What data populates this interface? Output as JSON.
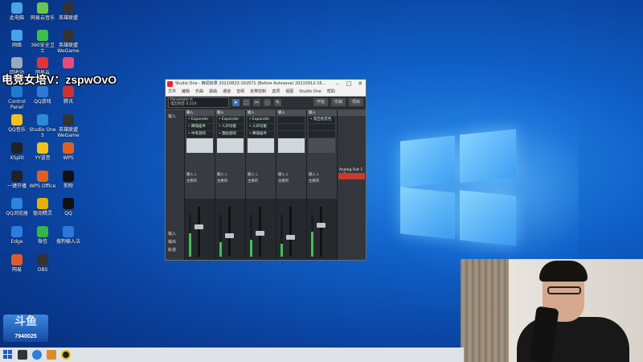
{
  "watermark": {
    "text": "电竞女培V：zspwOvO"
  },
  "desktop_icons": [
    {
      "label": "此电脑",
      "color": "#4aa3e8"
    },
    {
      "label": "网易云音乐",
      "color": "#65c84a"
    },
    {
      "label": "英雄联盟",
      "color": "#333333"
    },
    {
      "label": "网络",
      "color": "#4aa3e8"
    },
    {
      "label": "360安全卫士",
      "color": "#3dbf4a"
    },
    {
      "label": "英雄联盟WeGame",
      "color": "#333333"
    },
    {
      "label": "回收站",
      "color": "#9ab"
    },
    {
      "label": "网易云",
      "color": "#e2333b"
    },
    {
      "label": "",
      "color": "#e84b7a"
    },
    {
      "label": "Control Panel",
      "color": "#1f7bd0"
    },
    {
      "label": "QQ游戏",
      "color": "#2e7bd6"
    },
    {
      "label": "腾讯",
      "color": "#cc3333"
    },
    {
      "label": "QQ音乐",
      "color": "#f0c21a"
    },
    {
      "label": "Studio One 5",
      "color": "#2b8ad6"
    },
    {
      "label": "英雄联盟WeGame",
      "color": "#333333"
    },
    {
      "label": "XSplit",
      "color": "#222222"
    },
    {
      "label": "YY语音",
      "color": "#f2c31b"
    },
    {
      "label": "WPS",
      "color": "#e06020"
    },
    {
      "label": "一键开播",
      "color": "#222222"
    },
    {
      "label": "WPS Office",
      "color": "#e06020"
    },
    {
      "label": "剪映",
      "color": "#111111"
    },
    {
      "label": "QQ浏览器",
      "color": "#2f82e0"
    },
    {
      "label": "驱动精灵",
      "color": "#e6b000"
    },
    {
      "label": "QQ",
      "color": "#111111"
    },
    {
      "label": "Edge",
      "color": "#2c7de0"
    },
    {
      "label": "微信",
      "color": "#36b54a"
    },
    {
      "label": "搜狗输入法",
      "color": "#2b78d8"
    },
    {
      "label": "网易",
      "color": "#e05a2a"
    },
    {
      "label": "OBS",
      "color": "#333333"
    }
  ],
  "channel_badge": {
    "logo": "斗鱼",
    "label": "鲨鱼号",
    "id": "7940025"
  },
  "studio_one": {
    "title": "Studio One - 精调效果 20210823-162671 (Before Autosave) 20210912-16...",
    "menu": [
      "文件",
      "编辑",
      "乐曲",
      "歌曲",
      "通道",
      "音频",
      "走带控制",
      "选项",
      "视图",
      "Studio One",
      "帮助"
    ],
    "instrument": "Parameter 6",
    "instrument_sub": "电吉他音",
    "instrument_val": "0.214",
    "toolbar_buttons": [
      "开始",
      "乐曲",
      "项目"
    ],
    "side_labels": [
      "输入",
      "输出",
      "音量",
      "左右",
      "输入",
      "输出",
      "轨道"
    ],
    "strips": [
      {
        "header": "输入",
        "inserts": [
          "Expander",
          "降噪插件",
          "中等混响"
        ],
        "route_in": "输入 L",
        "route_out": "主要的",
        "level": 0.55
      },
      {
        "header": "输入",
        "inserts": [
          "Expander",
          "人声均衡",
          "激励混响"
        ],
        "route_in": "输入 L",
        "route_out": "主要的",
        "level": 0.35
      },
      {
        "header": "输入",
        "inserts": [
          "Expander",
          "人声均衡",
          "降噪插件"
        ],
        "route_in": "输入 L",
        "route_out": "主要的",
        "level": 0.4
      },
      {
        "header": "输入",
        "inserts": [],
        "route_in": "输入 L",
        "route_out": "主要的",
        "level": 0.3
      },
      {
        "header": "输入",
        "inserts": [
          "电吉他音色"
        ],
        "route_in": "输入 L",
        "route_out": "主要的",
        "level": 0.6
      }
    ],
    "right_panel": {
      "label": "Analog Out 1 + 2",
      "sub": "主要的"
    }
  }
}
